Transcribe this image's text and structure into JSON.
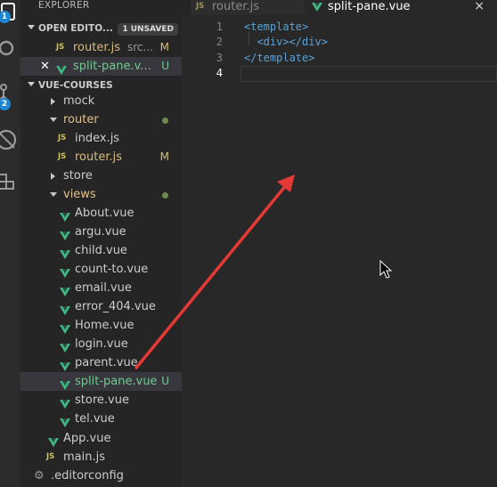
{
  "activity_bar": {
    "badges": [
      "1",
      "2"
    ],
    "icons": [
      "files-icon",
      "search-icon",
      "source-control-icon",
      "debug-icon",
      "extensions-icon"
    ]
  },
  "explorer": {
    "title": "EXPLORER",
    "open_editors": {
      "header": "OPEN EDITO...",
      "badge": "1 UNSAVED",
      "items": [
        {
          "icon": "js",
          "label": "router.js",
          "detail": "src...",
          "status": "M"
        },
        {
          "icon": "vue",
          "label": "split-pane.v...",
          "status": "U"
        }
      ]
    },
    "project": {
      "header": "VUE-COURSES",
      "tree": [
        {
          "type": "folder",
          "label": "mock"
        },
        {
          "type": "folder-open",
          "label": "router"
        },
        {
          "type": "js",
          "label": "index.js"
        },
        {
          "type": "js",
          "label": "router.js",
          "status": "M"
        },
        {
          "type": "folder",
          "label": "store"
        },
        {
          "type": "folder-open",
          "label": "views"
        },
        {
          "type": "vue",
          "label": "About.vue"
        },
        {
          "type": "vue",
          "label": "argu.vue"
        },
        {
          "type": "vue",
          "label": "child.vue"
        },
        {
          "type": "vue",
          "label": "count-to.vue"
        },
        {
          "type": "vue",
          "label": "email.vue"
        },
        {
          "type": "vue",
          "label": "error_404.vue"
        },
        {
          "type": "vue",
          "label": "Home.vue"
        },
        {
          "type": "vue",
          "label": "login.vue"
        },
        {
          "type": "vue",
          "label": "parent.vue"
        },
        {
          "type": "vue",
          "label": "split-pane.vue",
          "status": "U"
        },
        {
          "type": "vue",
          "label": "store.vue"
        },
        {
          "type": "vue",
          "label": "tel.vue"
        },
        {
          "type": "vue",
          "label": "App.vue"
        },
        {
          "type": "js",
          "label": "main.js"
        },
        {
          "type": "config",
          "label": ".editorconfig"
        }
      ]
    }
  },
  "tabs": [
    {
      "icon": "js",
      "label": "router.js",
      "active": false
    },
    {
      "icon": "vue",
      "label": "split-pane.vue",
      "active": true,
      "close": "×"
    }
  ],
  "editor": {
    "line_numbers": [
      "1",
      "2",
      "3",
      "4"
    ],
    "lines": [
      "<template>",
      "  <div></div>",
      "</template>",
      ""
    ]
  },
  "colors": {
    "js": "#cfc35c",
    "vue": "#41b883",
    "modified": "#d7ba7d",
    "untracked": "#73c991",
    "folder_open": "#e2c08d",
    "tag": "#5ba2d7",
    "annotation_arrow": "#e53935"
  }
}
